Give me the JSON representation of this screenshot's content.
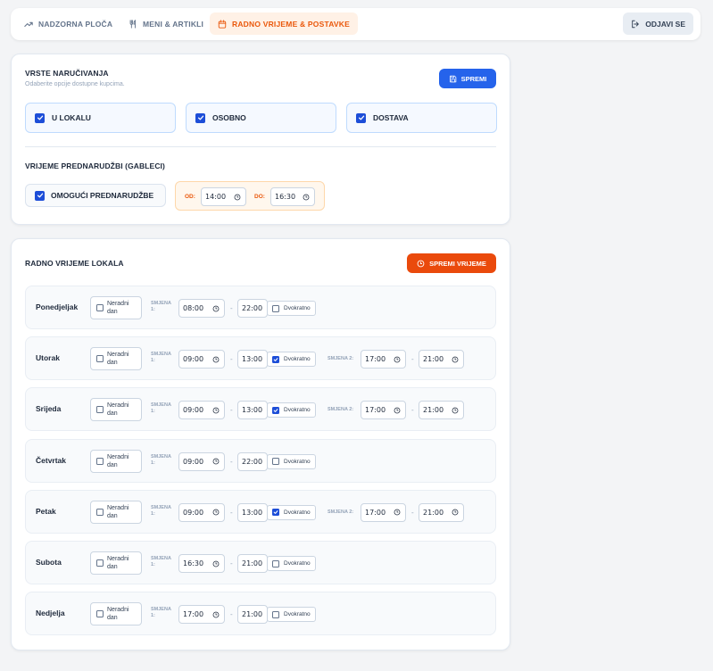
{
  "nav": {
    "tabs": [
      {
        "label": "NADZORNA PLOČA",
        "icon": "trend-icon"
      },
      {
        "label": "MENI & ARTIKLI",
        "icon": "utensils-icon"
      },
      {
        "label": "RADNO VRIJEME & POSTAVKE",
        "icon": "calendar-icon",
        "active": true
      }
    ],
    "logout_label": "ODJAVI SE"
  },
  "colors": {
    "accent_orange": "#ea4a0c",
    "accent_blue": "#2563eb"
  },
  "order_types": {
    "title": "VRSTE NARUČIVANJA",
    "subtitle": "Odaberite opcije dostupne kupcima.",
    "save_label": "SPREMI",
    "options": [
      {
        "label": "U LOKALU",
        "checked": true
      },
      {
        "label": "OSOBNO",
        "checked": true
      },
      {
        "label": "DOSTAVA",
        "checked": true
      }
    ]
  },
  "preorder": {
    "title": "VRIJEME PREDNARUDŽBI (GABLECI)",
    "toggle_label": "OMOGUĆI PREDNARUDŽBE",
    "enabled": true,
    "from_label": "OD:",
    "from_value": "14:00",
    "to_label": "DO:",
    "to_value": "16:30"
  },
  "hours": {
    "title": "RADNO VRIJEME LOKALA",
    "save_label": "SPREMI VRIJEME",
    "closed_label_1": "Neradni",
    "closed_label_2": "dan",
    "shift1_label_1": "SMJENA",
    "shift1_label_2": "1:",
    "shift2_label": "SMJENA 2:",
    "split_label": "Dvokratno",
    "dash": "-",
    "days": [
      {
        "name": "Ponedjeljak",
        "s1_from": "08:00",
        "s1_to": "22:00",
        "split": false
      },
      {
        "name": "Utorak",
        "s1_from": "09:00",
        "s1_to": "13:00",
        "split": true,
        "s2_from": "17:00",
        "s2_to": "21:00"
      },
      {
        "name": "Srijeda",
        "s1_from": "09:00",
        "s1_to": "13:00",
        "split": true,
        "s2_from": "17:00",
        "s2_to": "21:00"
      },
      {
        "name": "Četvrtak",
        "s1_from": "09:00",
        "s1_to": "22:00",
        "split": false
      },
      {
        "name": "Petak",
        "s1_from": "09:00",
        "s1_to": "13:00",
        "split": true,
        "s2_from": "17:00",
        "s2_to": "21:00"
      },
      {
        "name": "Subota",
        "s1_from": "16:30",
        "s1_to": "21:00",
        "split": false
      },
      {
        "name": "Nedjelja",
        "s1_from": "17:00",
        "s1_to": "21:00",
        "split": false
      }
    ]
  }
}
